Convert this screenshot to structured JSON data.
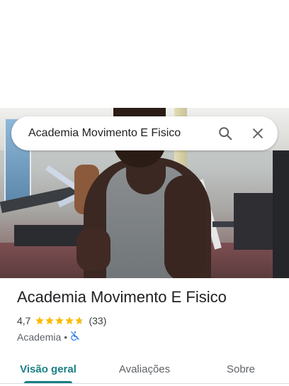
{
  "search": {
    "query": "Academia Movimento E Fisico"
  },
  "place": {
    "title": "Academia Movimento E Fisico",
    "rating_value": "4,7",
    "rating": 4.7,
    "reviews_count": "(33)",
    "category": "Academia",
    "separator": "•",
    "accessibility_icon": "not-wheelchair-accessible-icon"
  },
  "tabs": [
    {
      "label": "Visão geral",
      "active": true
    },
    {
      "label": "Avaliações",
      "active": false
    },
    {
      "label": "Sobre",
      "active": false
    }
  ],
  "colors": {
    "accent": "#1a7f86",
    "star": "#fbbc04",
    "accessibility": "#1a73e8"
  }
}
